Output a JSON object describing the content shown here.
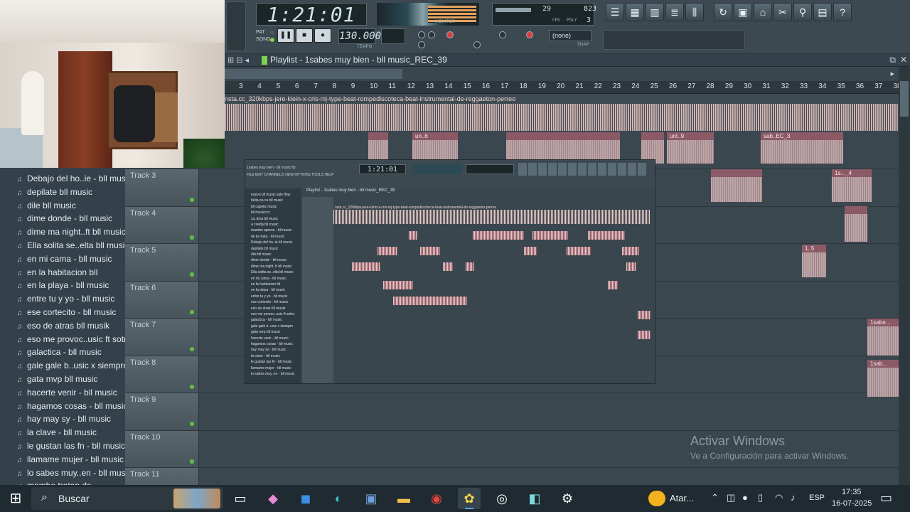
{
  "toolbar": {
    "time": "1:21:01",
    "cpu_value": "29",
    "ram_value": "823",
    "poly_value": "3",
    "cpu_label": "CPU",
    "poly_label": "POLY",
    "monitor_label": "MONITOR",
    "pat_label": "PAT",
    "song_label": "SONG",
    "tempo": "130.000",
    "tempo_label": "TEMPO",
    "snap_value": "(none)",
    "snap_label": "SNAP",
    "play_icon": "pause-icon",
    "stop_icon": "stop-icon",
    "rec_icon": "record-icon"
  },
  "playlist": {
    "title": "Playlist - 1sabes muy bien - bll music_REC_39",
    "ruler": [
      "3",
      "4",
      "5",
      "6",
      "7",
      "8",
      "9",
      "10",
      "11",
      "12",
      "13",
      "14",
      "15",
      "16",
      "17",
      "18",
      "19",
      "20",
      "21",
      "22",
      "23",
      "24",
      "25",
      "26",
      "27",
      "28",
      "29",
      "30",
      "31",
      "32",
      "33",
      "34",
      "35",
      "36",
      "37",
      "38"
    ],
    "track1_clip_label": "nsta.cc_320kbps-jere-klein-x-cris-mj-type-beat-rompediscoteca-beat-instrumental-de-reggaeton-perreo",
    "tracks": [
      {
        "name": "Track 3"
      },
      {
        "name": "Track 4"
      },
      {
        "name": "Track 5"
      },
      {
        "name": "Track 6"
      },
      {
        "name": "Track 7"
      },
      {
        "name": "Track 8"
      },
      {
        "name": "Track 9"
      },
      {
        "name": "Track 10"
      },
      {
        "name": "Track 11"
      }
    ],
    "clip_labels": {
      "c_un6": "un..6",
      "c_unt9": "unt..9",
      "c_sabEC3": "sab..EC_3",
      "c_1s4": "1s..._4",
      "c_15": "1..5",
      "c_1sabe": "1sabe...",
      "c_1sab": "1sab..."
    }
  },
  "browser": {
    "items": [
      "Debajo del ho..ie - bll music",
      "depilate bll music",
      "dile bll music",
      "dime donde - bll music",
      "dime ma night..ft bll music",
      "Ella solita se..elta  bll music",
      "en  mi cama - bll music",
      "en la habitacion bll",
      "en la playa - bll music",
      "entre tu y yo - bll music",
      "ese cortecito - bll music",
      "eso de atras bll musik",
      "eso me provoc..usic ft sotra",
      "galactica - bll music",
      "gale gale  b..usic x siempre",
      "gata mvp bll music",
      "hacerte venir - bll music",
      "hagamos cosas - bll music",
      "hay may sy - bll music",
      "la clave - bll music",
      "le gustan las fn - bll music",
      "llamame mujer - bll music",
      "lo sabes muy..en - bll music",
      "mambo tratan de"
    ]
  },
  "nested": {
    "title": "1sabes muy bien - bll music flp",
    "menu": "FILE  EDIT  CHANNELS  VIEW  OPTIONS  TOOLS  HELP",
    "time": "1:21:01",
    "playlist_title": "Playlist - 1sabes muy bien - bll music_REC_39",
    "wave_label": "nsta.cc_320kbps-jere-klein-x-cris-mj-type-beat-rompediscoteca-beat-instrumental-de-reggaeton-perreo",
    "browser_items": [
      "nuevo bll music vale flow",
      "bella pa ca bll music",
      "bll capeliz music",
      "bll musicccc",
      "ca..lima bll music",
      "a creida bll music",
      "mambo aprese - bll music",
      "de la mata - bll music",
      "Debajo del ho..ie bll music",
      "depilate bll music",
      "dile bll music",
      "dime donde - bll music",
      "dime ma night..ft bll music",
      "Ella solita se..elta bll music",
      "en  mi cama - bll music",
      "en la habitacion bll",
      "en la playa - bll music",
      "entre tu y yo - bll music",
      "ese cortecito - bll music",
      "eso de atras bll musik",
      "eso me provoc..usic ft sotra",
      "galactica - bll music",
      "gale gale  b..usic x siempre",
      "gata mvp bll music",
      "hacerte venir - bll music",
      "hagamos cosas - bll music",
      "hay may sy - bll music",
      "la clave - bll music",
      "le gustan las fn - bll music",
      "llamame mujer - bll music",
      "lo sabes muy..en - bll music"
    ]
  },
  "watermark": {
    "line1": "Activar Windows",
    "line2": "Ve a Configuración para activar Windows."
  },
  "taskbar": {
    "search_placeholder": "Buscar",
    "weather": "Atar...",
    "lang": "ESP",
    "time": "17:35",
    "date": "16-07-2025",
    "apps": [
      "task-view-icon",
      "copilot-icon",
      "outlook-icon",
      "edge-icon",
      "control-panel-icon",
      "file-explorer-icon",
      "chrome-icon",
      "fl-studio-icon",
      "obs-icon",
      "notes-icon",
      "settings-icon"
    ]
  }
}
